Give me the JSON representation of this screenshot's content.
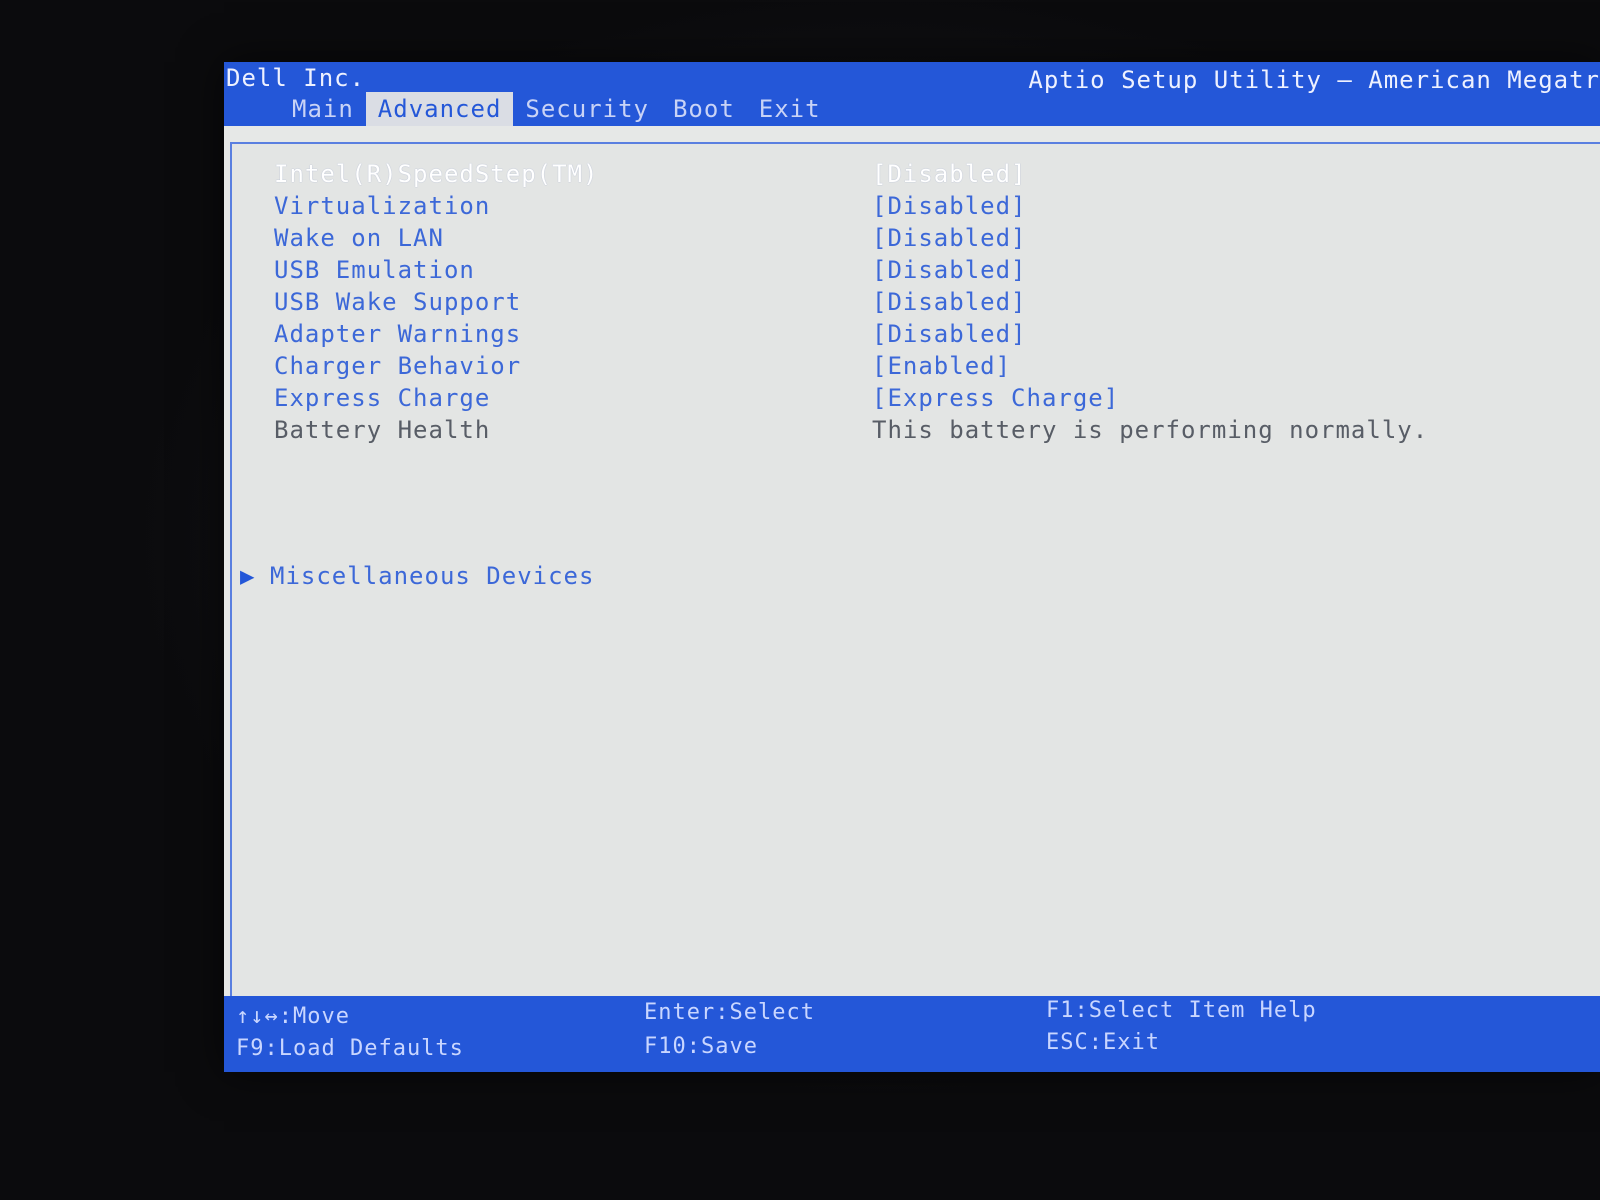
{
  "header": {
    "vendor": "Dell Inc.",
    "utility_title": "Aptio Setup Utility – American Megatr",
    "tabs": [
      {
        "label": "Main",
        "active": false
      },
      {
        "label": "Advanced",
        "active": true
      },
      {
        "label": "Security",
        "active": false
      },
      {
        "label": "Boot",
        "active": false
      },
      {
        "label": "Exit",
        "active": false
      }
    ]
  },
  "settings": [
    {
      "label": "Intel(R)SpeedStep(TM)",
      "value": "[Disabled]",
      "selected": true
    },
    {
      "label": "Virtualization",
      "value": "[Disabled]"
    },
    {
      "label": "Wake on LAN",
      "value": "[Disabled]"
    },
    {
      "label": "USB Emulation",
      "value": "[Disabled]"
    },
    {
      "label": "USB Wake Support",
      "value": "[Disabled]"
    },
    {
      "label": "Adapter Warnings",
      "value": "[Disabled]"
    },
    {
      "label": "Charger Behavior",
      "value": "[Enabled]"
    },
    {
      "label": "Express Charge",
      "value": "[Express Charge]"
    },
    {
      "label": "Battery Health",
      "value": "This battery is performing normally.",
      "static": true
    }
  ],
  "submenu": {
    "arrow": "▶",
    "label": "Miscellaneous Devices"
  },
  "footer": {
    "move": "↑↓↔:Move",
    "load_defaults": "F9:Load Defaults",
    "enter_select": "Enter:Select",
    "save": "F10:Save",
    "help": "F1:Select Item Help",
    "exit": "ESC:Exit"
  },
  "colors": {
    "bar_blue": "#2457d8",
    "body_bg": "#e3e5e4",
    "option_text": "#3c68d8",
    "selected_text": "#ffffff"
  }
}
